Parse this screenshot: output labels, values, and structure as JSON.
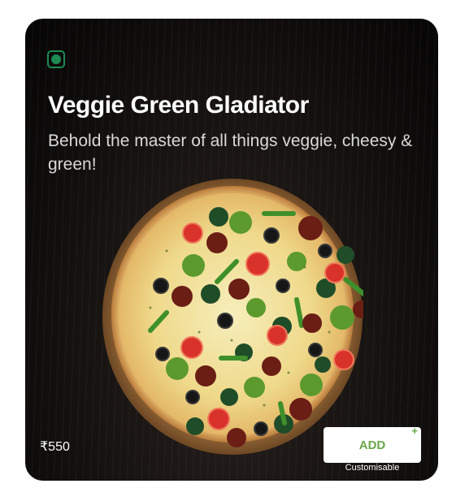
{
  "product": {
    "name": "Veggie Green Gladiator",
    "description": "Behold the master of all things veggie, cheesy & green!",
    "price": "₹550",
    "veg_indicator_icon": "veg-indicator-icon",
    "image_icon": "pizza-image"
  },
  "actions": {
    "add_label": "ADD",
    "add_plus": "+",
    "customisable_label": "Customisable"
  },
  "colors": {
    "veg_green": "#1e8a52",
    "add_text_green": "#6aa64a",
    "card_bg": "#0d0b0a"
  }
}
